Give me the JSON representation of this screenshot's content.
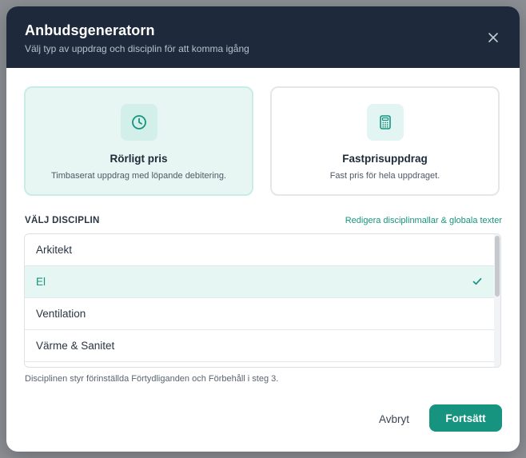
{
  "header": {
    "title": "Anbudsgeneratorn",
    "subtitle": "Välj typ av uppdrag och disciplin för att komma igång"
  },
  "pricing_options": [
    {
      "title": "Rörligt pris",
      "description": "Timbaserat uppdrag med löpande debitering.",
      "icon": "clock-icon",
      "selected": true
    },
    {
      "title": "Fastprisuppdrag",
      "description": "Fast pris för hela uppdraget.",
      "icon": "calculator-icon",
      "selected": false
    }
  ],
  "discipline": {
    "label": "VÄLJ DISCIPLIN",
    "edit_link": "Redigera disciplinmallar & globala texter",
    "items": [
      {
        "label": "Arkitekt",
        "selected": false
      },
      {
        "label": "El",
        "selected": true
      },
      {
        "label": "Ventilation",
        "selected": false
      },
      {
        "label": "Värme & Sanitet",
        "selected": false
      }
    ],
    "helper": "Disciplinen styr förinställda Förtydliganden och Förbehåll i steg 3."
  },
  "footer": {
    "cancel_label": "Avbryt",
    "continue_label": "Fortsätt"
  },
  "colors": {
    "header_bg": "#1e2a3b",
    "accent": "#16947f",
    "selected_bg": "#e6f6f2"
  }
}
